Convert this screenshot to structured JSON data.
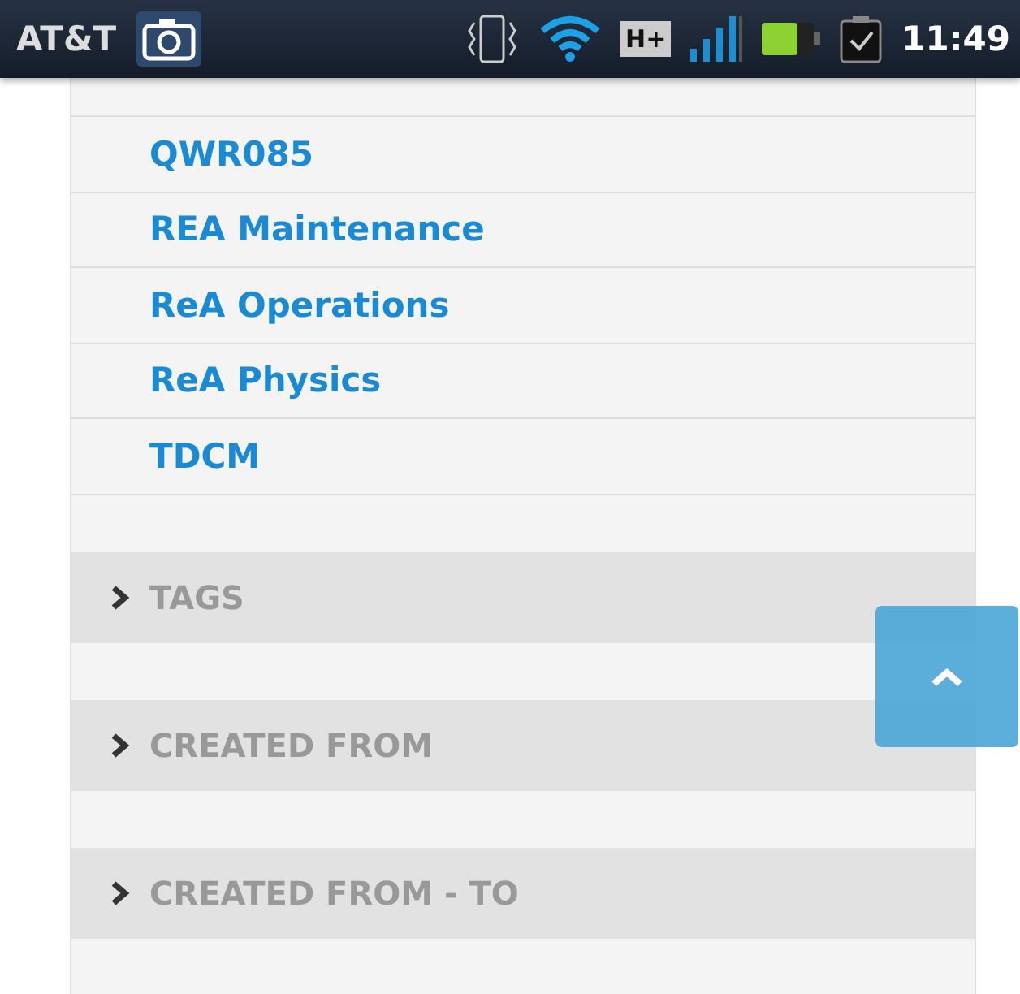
{
  "status_bar": {
    "carrier": "AT&T",
    "network_type": "H+",
    "time": "11:49"
  },
  "links": [
    "QWR085",
    "REA Maintenance",
    "ReA Operations",
    "ReA Physics",
    "TDCM"
  ],
  "sections": [
    {
      "label": "TAGS",
      "expanded": false
    },
    {
      "label": "CREATED FROM",
      "expanded": false
    },
    {
      "label": "CREATED FROM - TO",
      "expanded": false
    }
  ]
}
